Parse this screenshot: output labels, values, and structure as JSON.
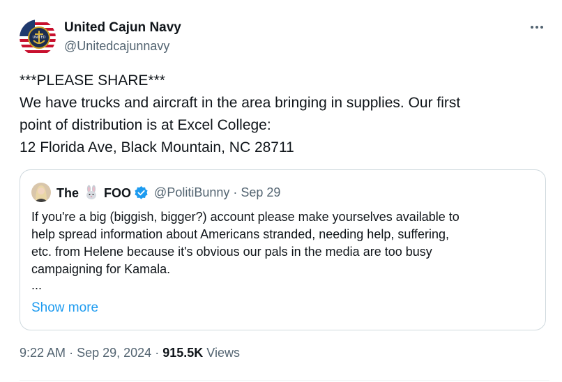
{
  "author": {
    "name": "United Cajun Navy",
    "handle": "@Unitedcajunnavy",
    "avatar_icon": "united-cajun-navy-logo",
    "avatar_text": "UNITED"
  },
  "more_icon": "more-horizontal-icon",
  "tweet": {
    "lines": [
      "***PLEASE SHARE***",
      "We have trucks and aircraft in the area bringing in supplies. Our first",
      "point of distribution is at Excel College:",
      "12 Florida Ave, Black Mountain, NC 28711"
    ]
  },
  "quote": {
    "name_part1": "The",
    "name_part2": "FOO",
    "name_emoji_icon": "rabbit-face-icon",
    "verified_icon": "verified-badge-icon",
    "handle": "@PolitiBunny",
    "separator": "·",
    "date": "Sep 29",
    "lines": [
      "If you're a big (biggish, bigger?) account please make yourselves available to",
      "help spread information about Americans stranded, needing help, suffering,",
      "etc. from Helene because it's obvious our pals in the media are too busy",
      "campaigning for Kamala.",
      "..."
    ],
    "show_more": "Show more"
  },
  "meta": {
    "time": "9:22 AM",
    "separator": "·",
    "date": "Sep 29, 2024",
    "views_count": "915.5K",
    "views_label": "Views"
  },
  "colors": {
    "text": "#0f1419",
    "secondary": "#536471",
    "link": "#1d9bf0",
    "border": "#cfd9de"
  }
}
